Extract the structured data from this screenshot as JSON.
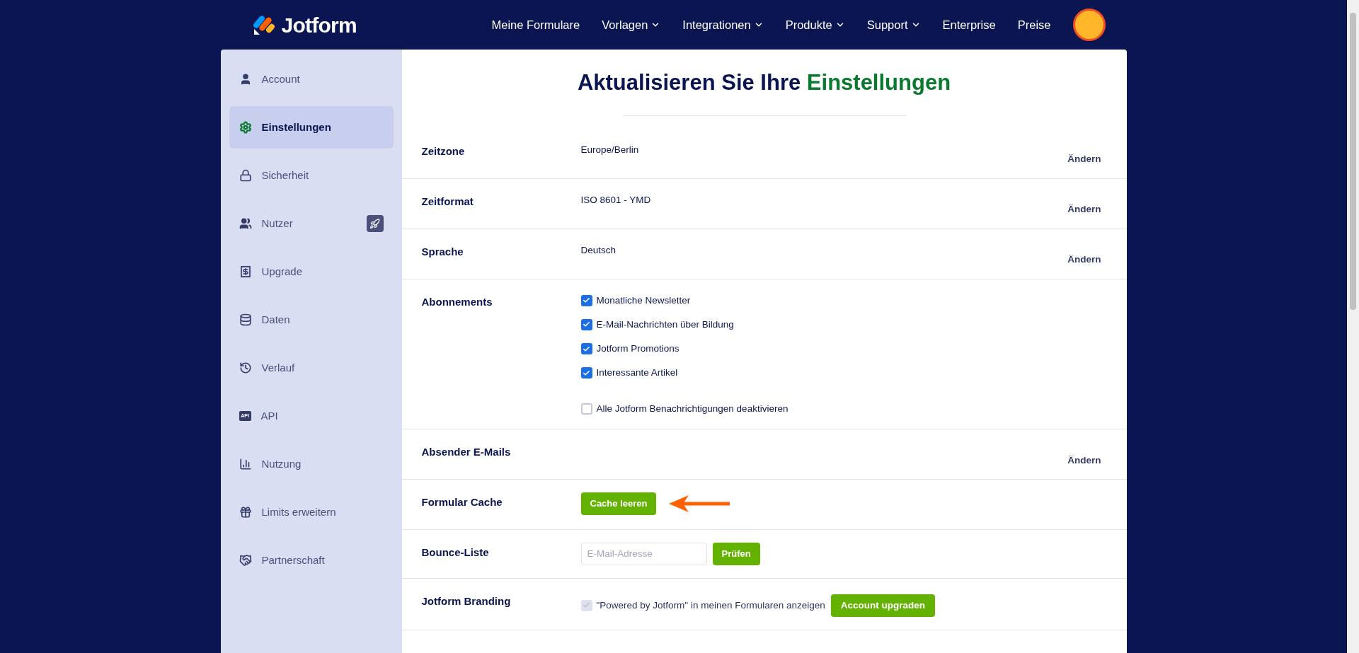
{
  "header": {
    "logo_text": "Jotform",
    "nav": [
      {
        "label": "Meine Formulare",
        "dropdown": false
      },
      {
        "label": "Vorlagen",
        "dropdown": true
      },
      {
        "label": "Integrationen",
        "dropdown": true
      },
      {
        "label": "Produkte",
        "dropdown": true
      },
      {
        "label": "Support",
        "dropdown": true
      },
      {
        "label": "Enterprise",
        "dropdown": false
      },
      {
        "label": "Preise",
        "dropdown": false
      }
    ]
  },
  "sidebar": {
    "items": [
      {
        "label": "Account",
        "selected": false,
        "badge": false
      },
      {
        "label": "Einstellungen",
        "selected": true,
        "badge": false
      },
      {
        "label": "Sicherheit",
        "selected": false,
        "badge": false
      },
      {
        "label": "Nutzer",
        "selected": false,
        "badge": true
      },
      {
        "label": "Upgrade",
        "selected": false,
        "badge": false
      },
      {
        "label": "Daten",
        "selected": false,
        "badge": false
      },
      {
        "label": "Verlauf",
        "selected": false,
        "badge": false
      },
      {
        "label": "API",
        "selected": false,
        "badge": false,
        "icon_text": "API"
      },
      {
        "label": "Nutzung",
        "selected": false,
        "badge": false
      },
      {
        "label": "Limits erweitern",
        "selected": false,
        "badge": false
      },
      {
        "label": "Partnerschaft",
        "selected": false,
        "badge": false
      }
    ]
  },
  "main": {
    "title": "Aktualisieren Sie Ihre",
    "title_highlight": "Einstellungen",
    "rows": [
      {
        "kind": "value",
        "label": "Zeitzone",
        "value": "Europe/Berlin",
        "action": "Ändern"
      },
      {
        "kind": "value",
        "label": "Zeitformat",
        "value": "ISO 8601 - YMD",
        "action": "Ändern"
      },
      {
        "kind": "value",
        "label": "Sprache",
        "value": "Deutsch",
        "action": "Ändern"
      },
      {
        "kind": "checkboxes",
        "label": "Abonnements",
        "options": [
          {
            "label": "Monatliche Newsletter",
            "checked": true
          },
          {
            "label": "E-Mail-Nachrichten über Bildung",
            "checked": true
          },
          {
            "label": "Jotform Promotions",
            "checked": true
          },
          {
            "label": "Interessante Artikel",
            "checked": true
          }
        ],
        "extra_option": {
          "label": "Alle Jotform Benachrichtigungen deaktivieren",
          "checked": false
        }
      },
      {
        "kind": "value",
        "label": "Absender E-Mails",
        "action": "Ändern"
      },
      {
        "kind": "button",
        "label": "Formular Cache",
        "button": "Cache leeren",
        "arrow": true
      },
      {
        "kind": "input",
        "label": "Bounce-Liste",
        "placeholder": "E-Mail-Adresse",
        "button": "Prüfen"
      },
      {
        "kind": "branding",
        "label": "Jotform Branding",
        "option": {
          "label": "\"Powered by Jotform\" in meinen Formularen anzeigen",
          "checked": true,
          "disabled": true
        },
        "button": "Account upgraden"
      }
    ]
  }
}
